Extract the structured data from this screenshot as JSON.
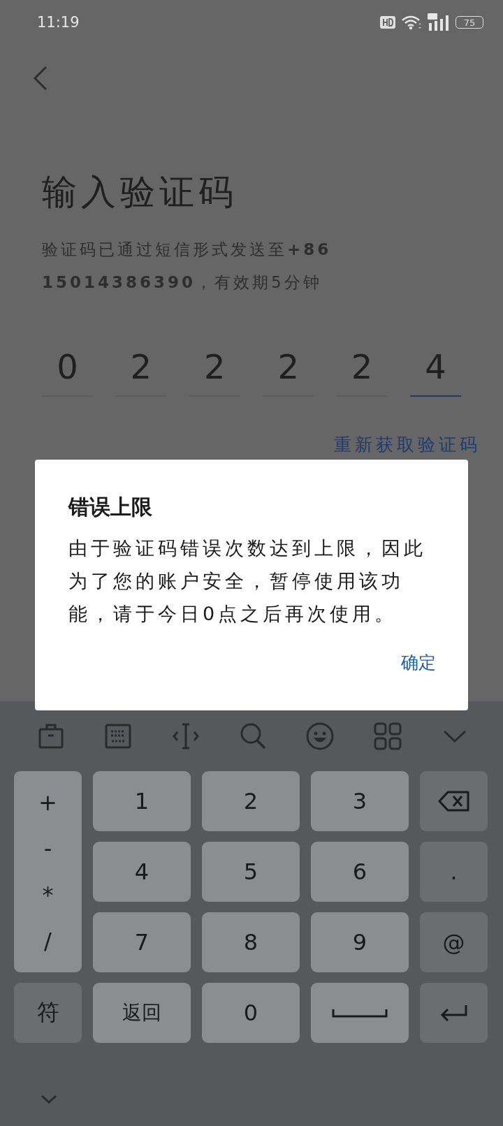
{
  "status_bar": {
    "time": "11:19",
    "battery": "75"
  },
  "title": "输入验证码",
  "subtitle": "验证码已通过短信形式发送至**+86 15014386390**，有效期5分钟",
  "code_digits": [
    {
      "digit": "0",
      "selected": false
    },
    {
      "digit": "2",
      "selected": false
    },
    {
      "digit": "2",
      "selected": false
    },
    {
      "digit": "2",
      "selected": false
    },
    {
      "digit": "2",
      "selected": false
    },
    {
      "digit": "4",
      "selected": true
    }
  ],
  "resend_link": "重新获取验证码",
  "dialog": {
    "title": "错误上限",
    "message": "由于验证码错误次数达到上限，因此为了您的账户安全，暂停使用该功能，请于今日0点之后再次使用。",
    "button": "确定"
  },
  "keyboard": {
    "keys": [
      {
        "kind": "symbols",
        "labels": [
          "+",
          "-",
          "*",
          "/"
        ]
      },
      {
        "kind": "char",
        "label": "1"
      },
      {
        "kind": "char",
        "label": "2"
      },
      {
        "kind": "char",
        "label": "3"
      },
      {
        "kind": "backspace"
      },
      {
        "kind": "char",
        "label": "4"
      },
      {
        "kind": "char",
        "label": "5"
      },
      {
        "kind": "char",
        "label": "6"
      },
      {
        "kind": "function",
        "label": "."
      },
      {
        "kind": "char",
        "label": "7"
      },
      {
        "kind": "char",
        "label": "8"
      },
      {
        "kind": "char",
        "label": "9"
      },
      {
        "kind": "function",
        "label": "@"
      },
      {
        "kind": "function",
        "label": "符"
      },
      {
        "kind": "char",
        "label": "返回"
      },
      {
        "kind": "char",
        "label": "0"
      },
      {
        "kind": "space"
      },
      {
        "kind": "enter"
      }
    ]
  }
}
